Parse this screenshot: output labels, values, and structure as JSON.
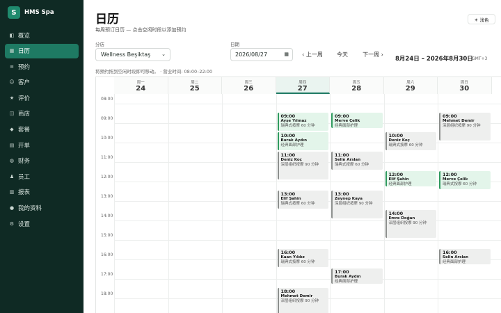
{
  "brand": {
    "logo": "S",
    "name": "HMS Spa"
  },
  "sidebar": {
    "items": [
      {
        "label": "概览",
        "icon": "◧",
        "active": false
      },
      {
        "label": "日历",
        "icon": "▦",
        "active": true
      },
      {
        "label": "预约",
        "icon": "≡",
        "active": false
      },
      {
        "label": "客户",
        "icon": "☺",
        "active": false
      },
      {
        "label": "评价",
        "icon": "★",
        "active": false
      },
      {
        "label": "商店",
        "icon": "◫",
        "active": false
      },
      {
        "label": "套餐",
        "icon": "◆",
        "active": false
      },
      {
        "label": "开单",
        "icon": "▤",
        "active": false
      },
      {
        "label": "财务",
        "icon": "◍",
        "active": false
      },
      {
        "label": "员工",
        "icon": "♟",
        "active": false
      },
      {
        "label": "报表",
        "icon": "▥",
        "active": false
      },
      {
        "label": "我的资料",
        "icon": "●",
        "active": false
      },
      {
        "label": "设置",
        "icon": "⚙",
        "active": false
      }
    ]
  },
  "header": {
    "title": "日历",
    "subtitle": "每周预订日历 — 点击空闲时段以添加预约",
    "theme_button": "☀ 浅色"
  },
  "filters": {
    "branch_label": "分店",
    "branch_value": "Wellness Beşiktaş",
    "date_label": "日期",
    "date_value": "2026/08/27",
    "prev_label": "‹ 上一周",
    "today_label": "今天",
    "next_label": "下一周 ›",
    "range_text": "8月24日 – 2026年8月30日",
    "timezone": "GMT+3"
  },
  "hint": "将预约拖到空闲时段即可移动。 · 营业时间: 08:00–22:00",
  "days": [
    {
      "weekday": "周一",
      "num": "24",
      "today": false
    },
    {
      "weekday": "周二",
      "num": "25",
      "today": false
    },
    {
      "weekday": "周三",
      "num": "26",
      "today": false
    },
    {
      "weekday": "周四",
      "num": "27",
      "today": true
    },
    {
      "weekday": "周五",
      "num": "28",
      "today": false
    },
    {
      "weekday": "周六",
      "num": "29",
      "today": false
    },
    {
      "weekday": "周日",
      "num": "30",
      "today": false
    }
  ],
  "hours": [
    "08:00",
    "09:00",
    "10:00",
    "11:00",
    "12:00",
    "13:00",
    "14:00",
    "15:00",
    "16:00",
    "17:00",
    "18:00"
  ],
  "appointments": [
    {
      "day": 3,
      "start": 9,
      "dur": 1,
      "time": "09:00",
      "name": "Ayşe Yılmaz",
      "service": "瑞典式按摩 60 分钟",
      "color": "green"
    },
    {
      "day": 3,
      "start": 10,
      "dur": 1,
      "time": "10:00",
      "name": "Burak Aydın",
      "service": "经典面部护理",
      "color": "green"
    },
    {
      "day": 3,
      "start": 11,
      "dur": 1.5,
      "time": "11:00",
      "name": "Deniz Koç",
      "service": "深层组织按摩 90 分钟",
      "color": "gray"
    },
    {
      "day": 3,
      "start": 13,
      "dur": 1,
      "time": "13:00",
      "name": "Elif Şahin",
      "service": "瑞典式按摩 60 分钟",
      "color": "gray"
    },
    {
      "day": 3,
      "start": 16,
      "dur": 1,
      "time": "16:00",
      "name": "Kaan Yıldız",
      "service": "瑞典式按摩 60 分钟",
      "color": "gray"
    },
    {
      "day": 3,
      "start": 18,
      "dur": 1.5,
      "time": "18:00",
      "name": "Mehmet Demir",
      "service": "深层组织按摩 90 分钟",
      "color": "gray"
    },
    {
      "day": 4,
      "start": 9,
      "dur": 0.8,
      "time": "09:00",
      "name": "Merve Çelik",
      "service": "经典面部护理",
      "color": "green"
    },
    {
      "day": 4,
      "start": 11,
      "dur": 1,
      "time": "11:00",
      "name": "Selin Arslan",
      "service": "瑞典式按摩 60 分钟",
      "color": "gray"
    },
    {
      "day": 4,
      "start": 13,
      "dur": 1.5,
      "time": "13:00",
      "name": "Zeynep Kaya",
      "service": "深层组织按摩 90 分钟",
      "color": "gray"
    },
    {
      "day": 4,
      "start": 17,
      "dur": 0.8,
      "time": "17:00",
      "name": "Burak Aydın",
      "service": "经典面部护理",
      "color": "gray"
    },
    {
      "day": 5,
      "start": 10,
      "dur": 1,
      "time": "10:00",
      "name": "Deniz Koç",
      "service": "瑞典式按摩 60 分钟",
      "color": "gray"
    },
    {
      "day": 5,
      "start": 12,
      "dur": 0.8,
      "time": "12:00",
      "name": "Elif Şahin",
      "service": "经典面部护理",
      "color": "green"
    },
    {
      "day": 5,
      "start": 14,
      "dur": 1.5,
      "time": "14:00",
      "name": "Emre Doğan",
      "service": "深层组织按摩 90 分钟",
      "color": "gray"
    },
    {
      "day": 6,
      "start": 9,
      "dur": 1.5,
      "time": "09:00",
      "name": "Mehmet Demir",
      "service": "深层组织按摩 90 分钟",
      "color": "gray"
    },
    {
      "day": 6,
      "start": 12,
      "dur": 1,
      "time": "12:00",
      "name": "Merve Çelik",
      "service": "瑞典式按摩 60 分钟",
      "color": "green"
    },
    {
      "day": 6,
      "start": 16,
      "dur": 0.8,
      "time": "16:00",
      "name": "Selin Arslan",
      "service": "经典面部护理",
      "color": "gray"
    }
  ]
}
